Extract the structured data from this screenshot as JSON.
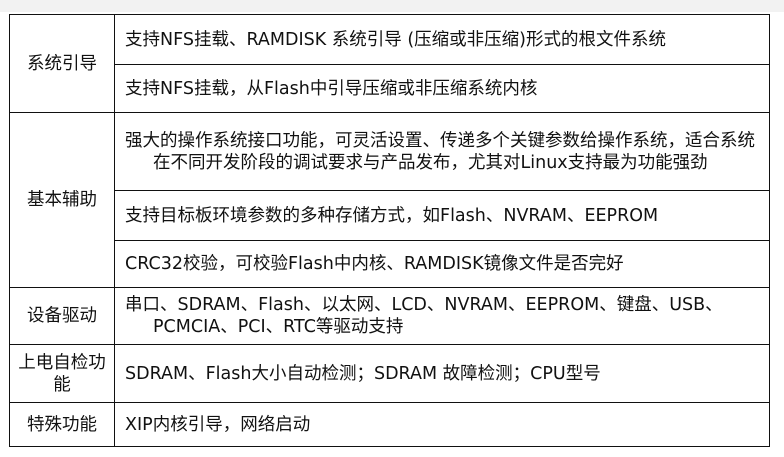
{
  "categories": [
    {
      "name": "系统引导",
      "items": [
        "支持NFS挂载、RAMDISK 系统引导 (压缩或非压缩)形式的根文件系统",
        "支持NFS挂载，从Flash中引导压缩或非压缩系统内核"
      ]
    },
    {
      "name": "基本辅助",
      "items": [
        "强大的操作系统接口功能，可灵活设置、传递多个关键参数给操作系统，适合系统在不同开发阶段的调试要求与产品发布，尤其对Linux支持最为功能强劲",
        "支持目标板环境参数的多种存储方式，如Flash、NVRAM、EEPROM",
        "CRC32校验，可校验Flash中内核、RAMDISK镜像文件是否完好"
      ]
    },
    {
      "name": "设备驱动",
      "items": [
        "串口、SDRAM、Flash、以太网、LCD、NVRAM、EEPROM、键盘、USB、PCMCIA、PCI、RTC等驱动支持"
      ]
    },
    {
      "name": "上电自检功能",
      "items": [
        "SDRAM、Flash大小自动检测；SDRAM 故障检测；CPU型号"
      ]
    },
    {
      "name": "特殊功能",
      "items": [
        "XIP内核引导，网络启动"
      ]
    }
  ]
}
